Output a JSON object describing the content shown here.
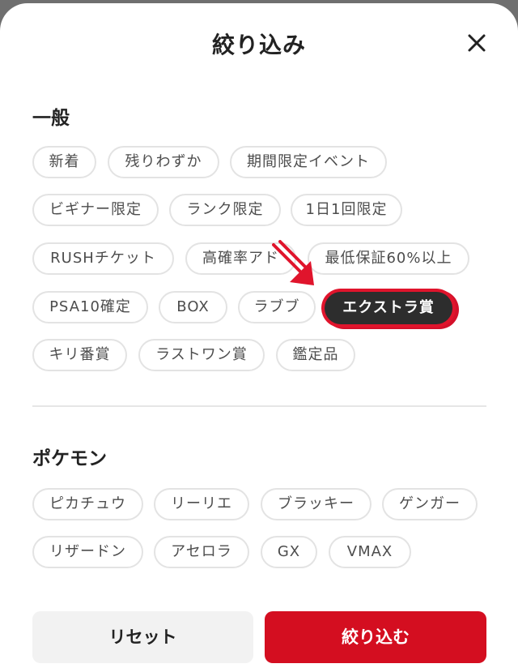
{
  "modal": {
    "title": "絞り込み"
  },
  "sections": {
    "general": {
      "title": "一般",
      "chips": [
        "新着",
        "残りわずか",
        "期間限定イベント",
        "ビギナー限定",
        "ランク限定",
        "1日1回限定",
        "RUSHチケット",
        "高確率アド",
        "最低保証60%以上",
        "PSA10確定",
        "BOX",
        "ラブブ",
        "エクストラ賞",
        "キリ番賞",
        "ラストワン賞",
        "鑑定品"
      ],
      "selected": "エクストラ賞"
    },
    "pokemon": {
      "title": "ポケモン",
      "chips": [
        "ピカチュウ",
        "リーリエ",
        "ブラッキー",
        "ゲンガー",
        "リザードン",
        "アセロラ",
        "GX",
        "VMAX"
      ]
    }
  },
  "buttons": {
    "reset": "リセット",
    "apply": "絞り込む"
  },
  "colors": {
    "accent": "#d40e20",
    "selected_chip": "#2d2d2d",
    "annotation": "#e0142c"
  },
  "icons": {
    "close": "close-icon",
    "annotation": "arrow-annotation-icon"
  }
}
